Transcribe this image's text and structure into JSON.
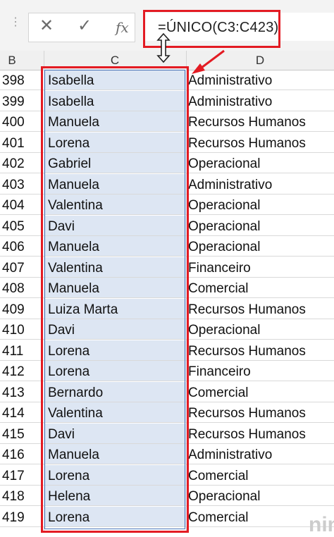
{
  "formula_bar": {
    "cancel_icon": "✕",
    "enter_icon": "✓",
    "fx_label": "fx",
    "formula": "=ÚNICO(C3:C423)"
  },
  "columns": {
    "b": "B",
    "c": "C",
    "d": "D"
  },
  "rows": [
    {
      "num": "398",
      "name": "Isabella",
      "dept": "Administrativo"
    },
    {
      "num": "399",
      "name": "Isabella",
      "dept": "Administrativo"
    },
    {
      "num": "400",
      "name": "Manuela",
      "dept": "Recursos Humanos"
    },
    {
      "num": "401",
      "name": "Lorena",
      "dept": "Recursos Humanos"
    },
    {
      "num": "402",
      "name": "Gabriel",
      "dept": "Operacional"
    },
    {
      "num": "403",
      "name": "Manuela",
      "dept": "Administrativo"
    },
    {
      "num": "404",
      "name": "Valentina",
      "dept": "Operacional"
    },
    {
      "num": "405",
      "name": "Davi",
      "dept": "Operacional"
    },
    {
      "num": "406",
      "name": "Manuela",
      "dept": "Operacional"
    },
    {
      "num": "407",
      "name": "Valentina",
      "dept": "Financeiro"
    },
    {
      "num": "408",
      "name": "Manuela",
      "dept": "Comercial"
    },
    {
      "num": "409",
      "name": "Luiza Marta",
      "dept": "Recursos Humanos"
    },
    {
      "num": "410",
      "name": "Davi",
      "dept": "Operacional"
    },
    {
      "num": "411",
      "name": "Lorena",
      "dept": "Recursos Humanos"
    },
    {
      "num": "412",
      "name": "Lorena",
      "dept": "Financeiro"
    },
    {
      "num": "413",
      "name": "Bernardo",
      "dept": "Comercial"
    },
    {
      "num": "414",
      "name": "Valentina",
      "dept": "Recursos Humanos"
    },
    {
      "num": "415",
      "name": "Davi",
      "dept": "Recursos Humanos"
    },
    {
      "num": "416",
      "name": "Manuela",
      "dept": "Administrativo"
    },
    {
      "num": "417",
      "name": "Lorena",
      "dept": "Comercial"
    },
    {
      "num": "418",
      "name": "Helena",
      "dept": "Operacional"
    },
    {
      "num": "419",
      "name": "Lorena",
      "dept": "Comercial"
    }
  ],
  "watermark": "nin",
  "colors": {
    "highlight": "#e31b23",
    "selection_fill": "#dde6f3",
    "selection_border": "#4a72b5"
  }
}
